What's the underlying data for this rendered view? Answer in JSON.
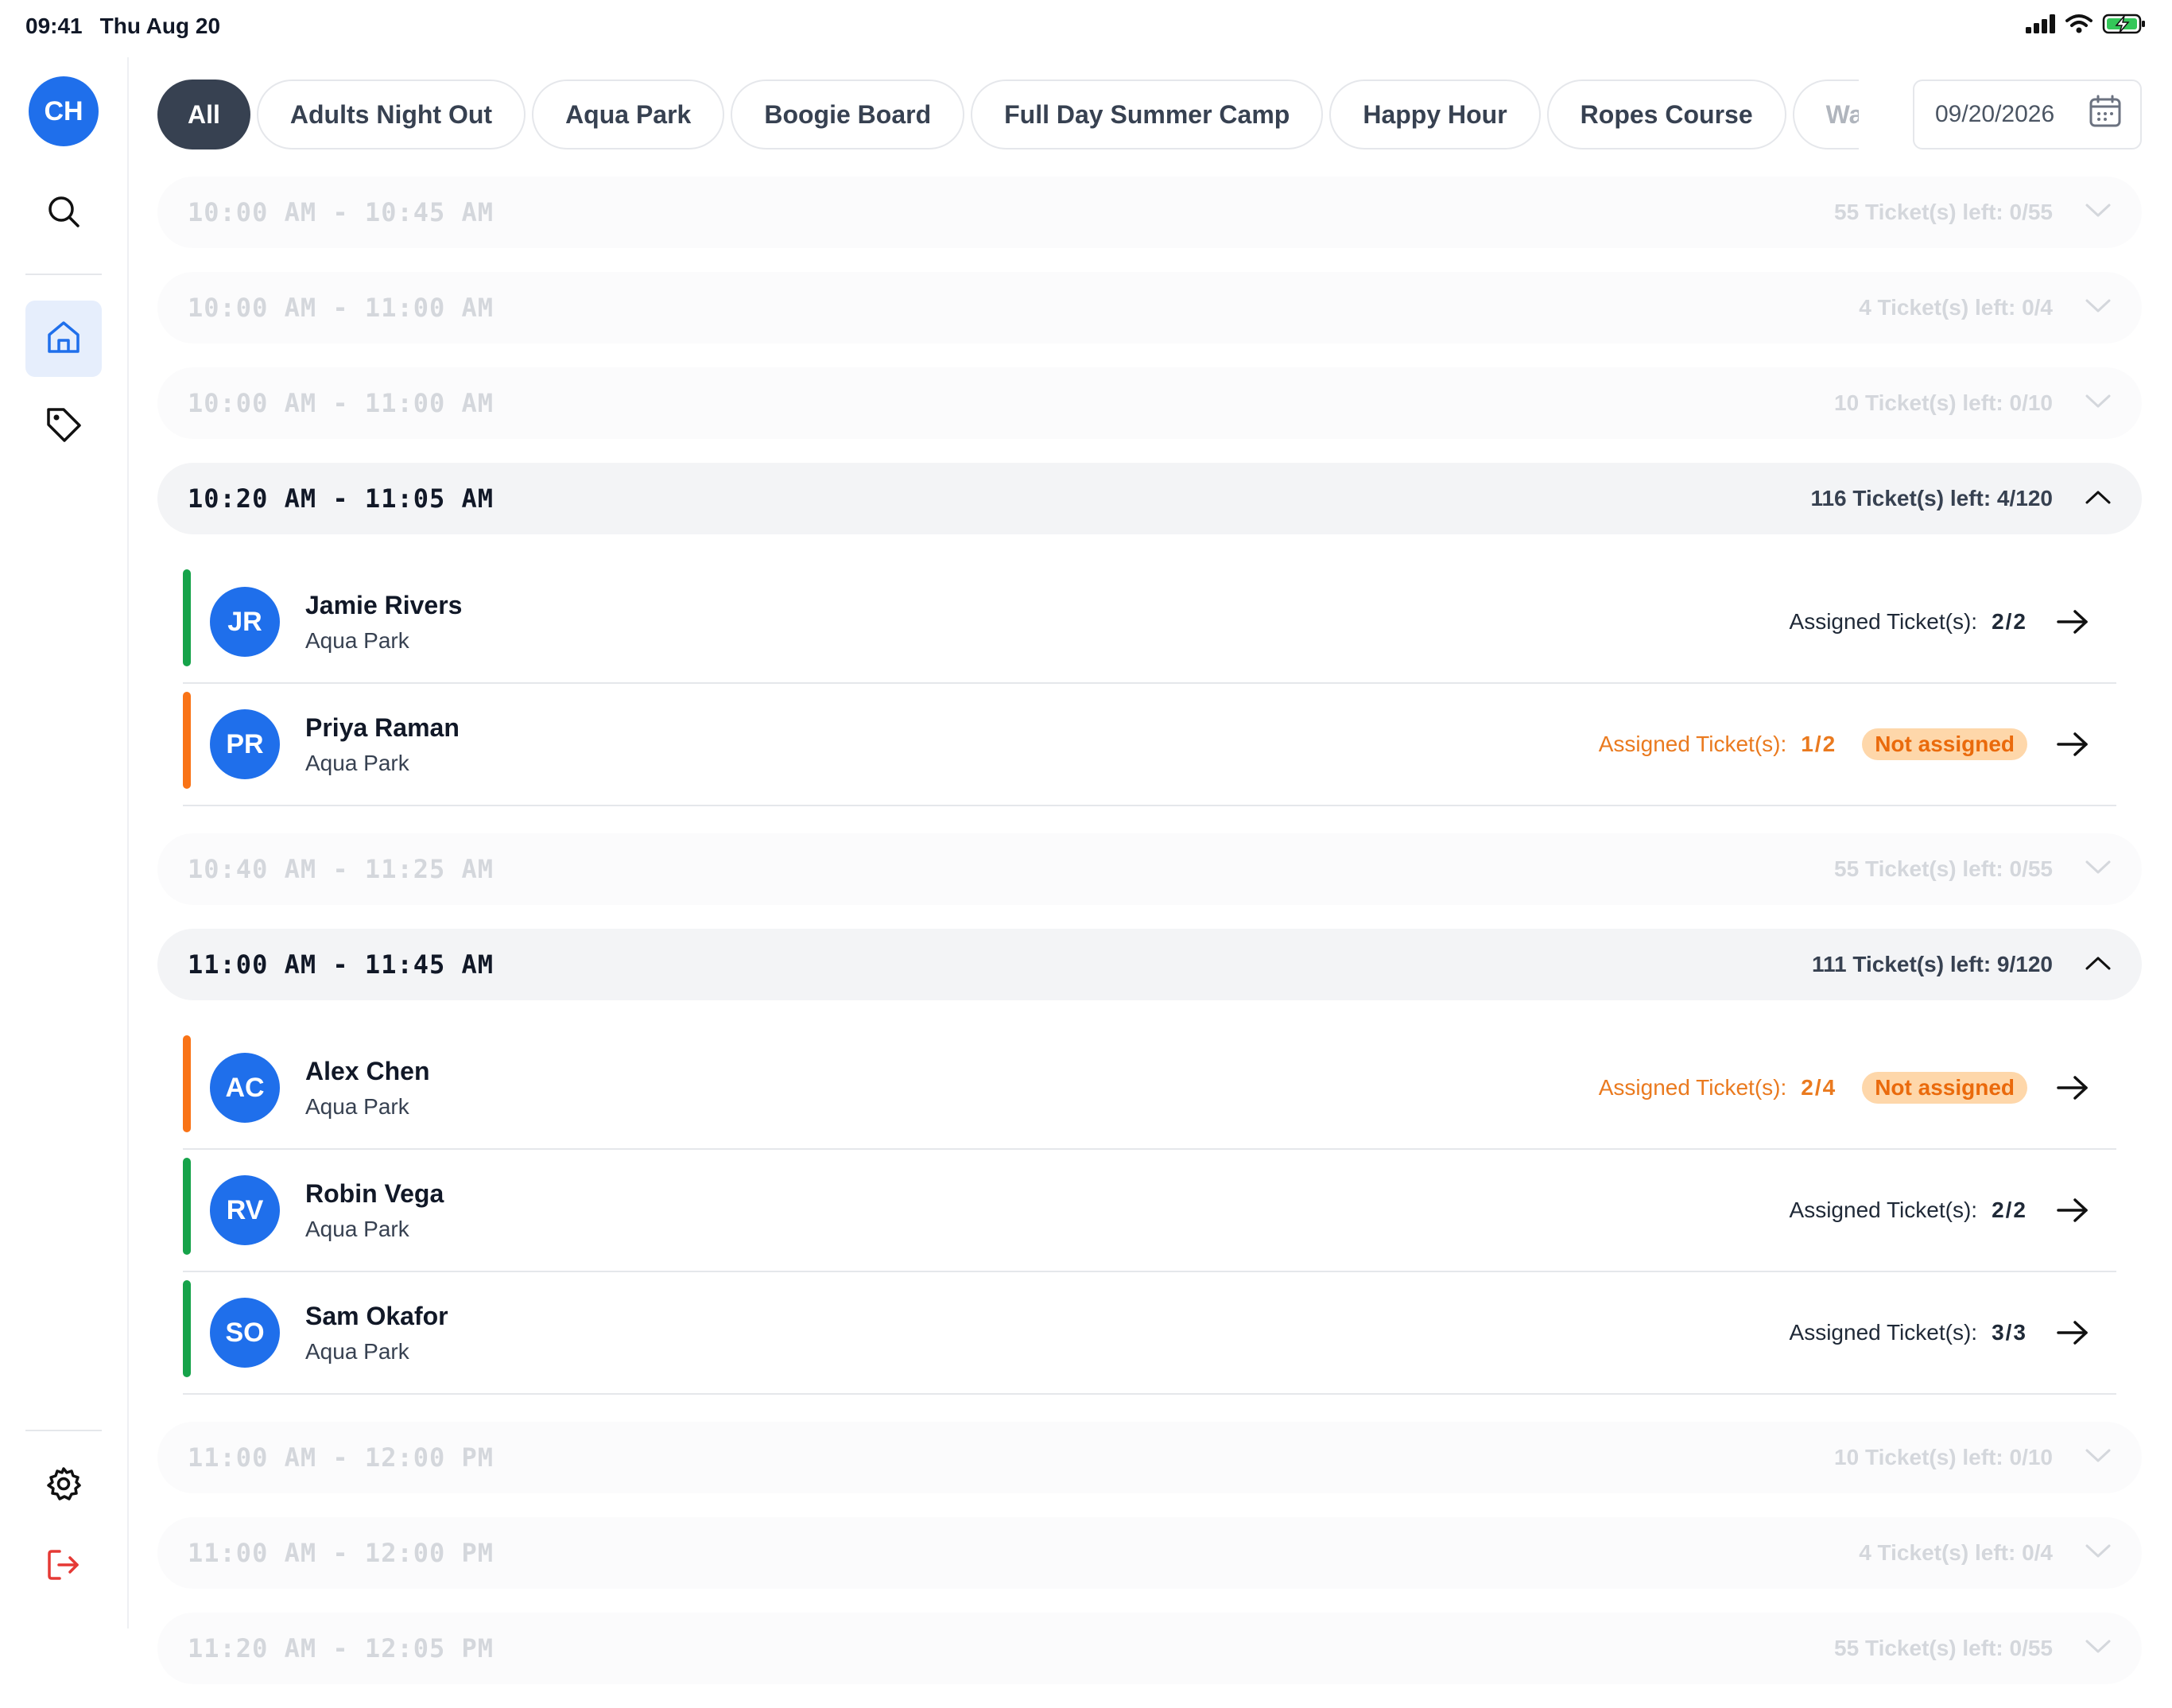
{
  "status_bar": {
    "time": "09:41",
    "date": "Thu Aug 20"
  },
  "sidebar": {
    "avatar_initials": "CH",
    "items": [
      "search-icon",
      "home-icon",
      "tag-icon"
    ],
    "bottom_items": [
      "gear-icon",
      "logout-icon"
    ]
  },
  "filters": {
    "chips": [
      "All",
      "Adults Night Out",
      "Aqua Park",
      "Boogie Board",
      "Full Day Summer Camp",
      "Happy Hour",
      "Ropes Course",
      "Wak"
    ],
    "active": "All",
    "date": "09/20/2026"
  },
  "slots": [
    {
      "time": "10:00 AM - 10:45 AM",
      "tickets": "55 Ticket(s) left: 0/55",
      "expanded": false
    },
    {
      "time": "10:00 AM - 11:00 AM",
      "tickets": "4 Ticket(s) left: 0/4",
      "expanded": false
    },
    {
      "time": "10:00 AM - 11:00 AM",
      "tickets": "10 Ticket(s) left: 0/10",
      "expanded": false
    },
    {
      "time": "10:20 AM - 11:05 AM",
      "tickets": "116 Ticket(s) left: 4/120",
      "expanded": true,
      "bookings": [
        {
          "initials": "JR",
          "name": "Jamie Rivers",
          "activity": "Aqua Park",
          "assigned_label": "Assigned Ticket(s):",
          "assigned": "2/2",
          "complete": true,
          "status_color": "#16a34a"
        },
        {
          "initials": "PR",
          "name": "Priya Raman",
          "activity": "Aqua Park",
          "assigned_label": "Assigned Ticket(s):",
          "assigned": "1/2",
          "complete": false,
          "badge": "Not assigned",
          "status_color": "#f97316"
        }
      ]
    },
    {
      "time": "10:40 AM - 11:25 AM",
      "tickets": "55 Ticket(s) left: 0/55",
      "expanded": false
    },
    {
      "time": "11:00 AM - 11:45 AM",
      "tickets": "111 Ticket(s) left: 9/120",
      "expanded": true,
      "bookings": [
        {
          "initials": "AC",
          "name": "Alex Chen",
          "activity": "Aqua Park",
          "assigned_label": "Assigned Ticket(s):",
          "assigned": "2/4",
          "complete": false,
          "badge": "Not assigned",
          "status_color": "#f97316"
        },
        {
          "initials": "RV",
          "name": "Robin Vega",
          "activity": "Aqua Park",
          "assigned_label": "Assigned Ticket(s):",
          "assigned": "2/2",
          "complete": true,
          "status_color": "#16a34a"
        },
        {
          "initials": "SO",
          "name": "Sam Okafor",
          "activity": "Aqua Park",
          "assigned_label": "Assigned Ticket(s):",
          "assigned": "3/3",
          "complete": true,
          "status_color": "#16a34a"
        }
      ]
    },
    {
      "time": "11:00 AM - 12:00 PM",
      "tickets": "10 Ticket(s) left: 0/10",
      "expanded": false
    },
    {
      "time": "11:00 AM - 12:00 PM",
      "tickets": "4 Ticket(s) left: 0/4",
      "expanded": false
    },
    {
      "time": "11:20 AM - 12:05 PM",
      "tickets": "55 Ticket(s) left: 0/55",
      "expanded": false
    }
  ],
  "colors": {
    "accent": "#1f6feb",
    "warning": "#ea7a1f",
    "success": "#16a34a",
    "logout": "#e53935"
  }
}
